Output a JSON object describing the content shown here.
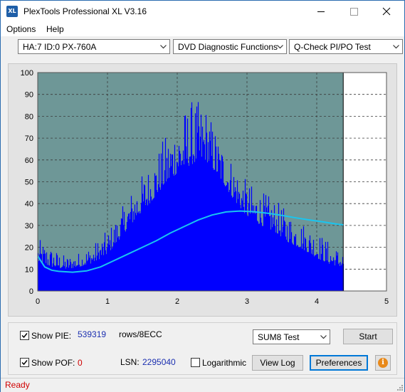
{
  "window": {
    "title": "PlexTools Professional XL V3.16",
    "app_icon_text": "XL"
  },
  "menu": {
    "options": "Options",
    "help": "Help"
  },
  "toolbar": {
    "drive": "HA:7 ID:0  PX-760A",
    "function": "DVD Diagnostic Functions",
    "test": "Q-Check PI/PO Test"
  },
  "chart_data": {
    "type": "area",
    "xlim": [
      0,
      5
    ],
    "ylim": [
      0,
      100
    ],
    "x_ticks": [
      "0",
      "1",
      "2",
      "3",
      "4",
      "5"
    ],
    "y_ticks": [
      "0",
      "10",
      "20",
      "30",
      "40",
      "50",
      "60",
      "70",
      "80",
      "90",
      "100"
    ],
    "grid": true,
    "end_marker_x": 4.38,
    "colors": {
      "plot_bg": "#6e9797",
      "bars": "#0000ff",
      "avg_line": "#19c5f0",
      "after_end": "#ffffff"
    },
    "series": [
      {
        "type": "bars",
        "x": [
          0.0,
          0.2,
          0.4,
          0.6,
          0.8,
          1.0,
          1.2,
          1.4,
          1.6,
          1.8,
          2.0,
          2.2,
          2.4,
          2.6,
          2.8,
          3.0,
          3.2,
          3.4,
          3.6,
          3.8,
          4.0,
          4.2,
          4.38
        ],
        "peak": [
          24,
          20,
          16,
          18,
          22,
          28,
          38,
          50,
          58,
          70,
          80,
          88,
          86,
          70,
          60,
          50,
          46,
          42,
          36,
          32,
          28,
          22,
          18
        ],
        "base": [
          13,
          11,
          10,
          11,
          13,
          17,
          25,
          33,
          40,
          48,
          54,
          58,
          60,
          52,
          42,
          34,
          30,
          27,
          22,
          19,
          15,
          12,
          11
        ]
      },
      {
        "type": "line",
        "x": [
          0.0,
          0.1,
          0.2,
          0.3,
          0.5,
          0.7,
          0.9,
          1.1,
          1.3,
          1.5,
          1.7,
          1.9,
          2.1,
          2.3,
          2.5,
          2.7,
          2.9,
          3.1,
          3.3,
          3.5,
          3.7,
          3.9,
          4.1,
          4.3,
          4.38
        ],
        "y": [
          16,
          11,
          9.5,
          9,
          8.6,
          9.2,
          11,
          14,
          17,
          20,
          23,
          26.5,
          29.5,
          32.5,
          34.8,
          36.2,
          36.6,
          36.3,
          35.6,
          34.6,
          33.5,
          32.5,
          31.6,
          30.6,
          30.3
        ]
      }
    ]
  },
  "controls": {
    "show_pie_label": "Show PIE:",
    "pie_value": "539319",
    "pie_unit": "rows/8ECC",
    "show_pof_label": "Show POF:",
    "pof_value": "0",
    "lsn_label": "LSN:",
    "lsn_value": "2295040",
    "logarithmic_label": "Logarithmic",
    "sum_select": "SUM8 Test",
    "start": "Start",
    "view_log": "View Log",
    "preferences": "Preferences",
    "info_icon_text": "i"
  },
  "status": {
    "text": "Ready"
  }
}
